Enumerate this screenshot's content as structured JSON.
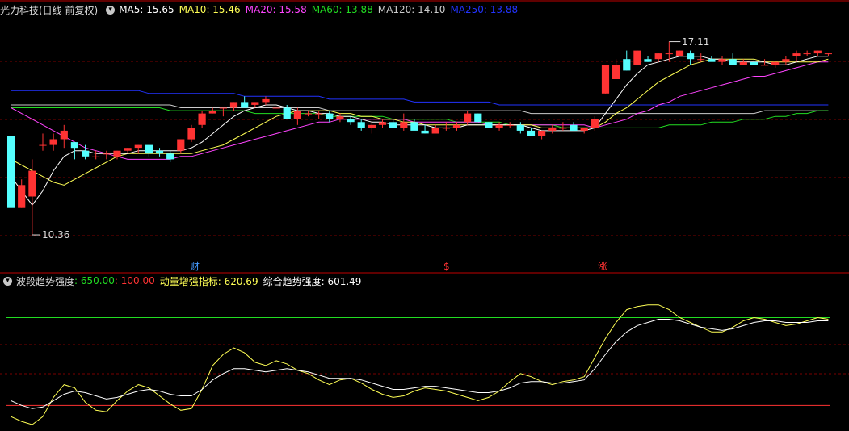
{
  "main_legend": {
    "title": "光力科技(日线 前复权)",
    "ma": [
      {
        "label": "MA5: 15.65",
        "color": "#ffffff"
      },
      {
        "label": "MA10: 15.46",
        "color": "#ffff55"
      },
      {
        "label": "MA20: 15.58",
        "color": "#ff44ff"
      },
      {
        "label": "MA60: 13.88",
        "color": "#22dd22"
      },
      {
        "label": "MA120: 14.10",
        "color": "#cccccc"
      },
      {
        "label": "MA250: 13.88",
        "color": "#2233ff"
      }
    ]
  },
  "sub_legend": {
    "name": "波段趋势强度",
    "val1": ": 650.00",
    "val2": ": 100.00",
    "ind2": "动量增强指标: 620.69",
    "ind3": "综合趋势强度: 601.49"
  },
  "markers": {
    "high": "17.11",
    "low": "10.36",
    "m1": "财",
    "m2": "$",
    "m3": "涨"
  },
  "colors": {
    "up": "#ff3333",
    "down": "#55ffff",
    "grid": "#7a0000",
    "sep": "#c00000"
  },
  "chart_data": [
    {
      "type": "candlestick",
      "title": "光力科技(日线 前复权)",
      "ylim": [
        9.6,
        18.0
      ],
      "ohlc": [
        [
          13.8,
          13.8,
          11.3,
          11.3
        ],
        [
          11.3,
          12.3,
          11.3,
          12.1
        ],
        [
          11.7,
          13.0,
          10.36,
          12.6
        ],
        [
          13.5,
          13.9,
          13.3,
          13.5
        ],
        [
          13.5,
          13.9,
          13.3,
          13.7
        ],
        [
          13.7,
          14.2,
          13.4,
          14.0
        ],
        [
          13.6,
          13.6,
          13.0,
          13.4
        ],
        [
          13.3,
          13.5,
          13.0,
          13.1
        ],
        [
          13.1,
          13.3,
          13.0,
          13.1
        ],
        [
          13.2,
          13.3,
          13.0,
          13.2
        ],
        [
          13.1,
          13.3,
          13.0,
          13.3
        ],
        [
          13.3,
          13.4,
          13.2,
          13.4
        ],
        [
          13.4,
          13.5,
          13.2,
          13.5
        ],
        [
          13.5,
          13.5,
          13.1,
          13.2
        ],
        [
          13.3,
          13.4,
          13.1,
          13.2
        ],
        [
          13.2,
          13.3,
          12.9,
          13.0
        ],
        [
          13.3,
          13.7,
          13.2,
          13.7
        ],
        [
          13.7,
          14.2,
          13.6,
          14.1
        ],
        [
          14.2,
          14.7,
          14.1,
          14.6
        ],
        [
          14.6,
          14.8,
          14.6,
          14.7
        ],
        [
          14.8,
          14.8,
          14.5,
          14.8
        ],
        [
          14.8,
          15.0,
          14.7,
          15.0
        ],
        [
          15.0,
          15.2,
          14.8,
          14.8
        ],
        [
          14.9,
          15.0,
          14.8,
          15.0
        ],
        [
          15.0,
          15.2,
          14.9,
          15.1
        ],
        [
          14.8,
          14.8,
          14.8,
          14.8
        ],
        [
          14.8,
          14.9,
          14.4,
          14.4
        ],
        [
          14.4,
          14.8,
          14.2,
          14.7
        ],
        [
          14.6,
          14.7,
          14.5,
          14.6
        ],
        [
          14.6,
          14.7,
          14.4,
          14.6
        ],
        [
          14.6,
          14.7,
          14.3,
          14.4
        ],
        [
          14.4,
          14.6,
          14.3,
          14.5
        ],
        [
          14.4,
          14.5,
          14.2,
          14.3
        ],
        [
          14.3,
          14.4,
          14.0,
          14.1
        ],
        [
          14.1,
          14.3,
          13.9,
          14.2
        ],
        [
          14.2,
          14.4,
          14.1,
          14.3
        ],
        [
          14.3,
          14.4,
          14.1,
          14.1
        ],
        [
          14.1,
          14.6,
          14.0,
          14.3
        ],
        [
          14.3,
          14.4,
          14.1,
          14.0
        ],
        [
          14.0,
          14.2,
          13.9,
          13.9
        ],
        [
          13.9,
          14.2,
          13.9,
          14.1
        ],
        [
          14.1,
          14.3,
          14.0,
          14.1
        ],
        [
          14.1,
          14.3,
          14.0,
          14.2
        ],
        [
          14.3,
          14.7,
          14.2,
          14.6
        ],
        [
          14.6,
          14.6,
          14.3,
          14.3
        ],
        [
          14.3,
          14.3,
          14.1,
          14.1
        ],
        [
          14.1,
          14.3,
          14.0,
          14.2
        ],
        [
          14.2,
          14.3,
          14.1,
          14.2
        ],
        [
          14.2,
          14.3,
          13.9,
          14.0
        ],
        [
          14.0,
          14.1,
          13.8,
          13.8
        ],
        [
          13.8,
          14.0,
          13.7,
          14.0
        ],
        [
          14.0,
          14.2,
          13.9,
          14.1
        ],
        [
          14.1,
          14.3,
          14.0,
          14.1
        ],
        [
          14.2,
          14.3,
          14.0,
          14.0
        ],
        [
          14.0,
          14.1,
          13.9,
          14.1
        ],
        [
          14.1,
          14.5,
          14.0,
          14.4
        ],
        [
          15.3,
          16.2,
          15.3,
          16.3
        ],
        [
          15.8,
          16.5,
          15.8,
          16.3
        ],
        [
          16.5,
          16.8,
          16.1,
          16.1
        ],
        [
          16.3,
          16.8,
          16.3,
          16.8
        ],
        [
          16.5,
          16.6,
          16.4,
          16.4
        ],
        [
          16.5,
          16.7,
          16.4,
          16.7
        ],
        [
          16.7,
          17.11,
          16.4,
          16.7
        ],
        [
          16.6,
          16.8,
          16.6,
          16.8
        ],
        [
          16.7,
          16.8,
          16.3,
          16.5
        ],
        [
          16.5,
          16.7,
          16.4,
          16.5
        ],
        [
          16.5,
          16.6,
          16.5,
          16.4
        ],
        [
          16.4,
          16.6,
          16.3,
          16.5
        ],
        [
          16.5,
          16.7,
          16.4,
          16.3
        ],
        [
          16.3,
          16.5,
          16.3,
          16.4
        ],
        [
          16.4,
          16.5,
          16.3,
          16.3
        ],
        [
          16.3,
          16.5,
          16.3,
          16.3
        ],
        [
          16.3,
          16.4,
          16.2,
          16.4
        ],
        [
          16.4,
          16.6,
          16.3,
          16.5
        ],
        [
          16.6,
          16.8,
          16.4,
          16.7
        ],
        [
          16.7,
          16.8,
          16.6,
          16.7
        ],
        [
          16.7,
          16.8,
          16.6,
          16.8
        ],
        [
          16.7,
          16.7,
          16.6,
          16.7
        ]
      ],
      "ma5": [
        12.4,
        11.9,
        11.4,
        11.9,
        12.6,
        13.1,
        13.3,
        13.3,
        13.2,
        13.2,
        13.2,
        13.2,
        13.3,
        13.3,
        13.3,
        13.3,
        13.3,
        13.4,
        13.6,
        13.9,
        14.2,
        14.5,
        14.7,
        14.8,
        14.9,
        14.9,
        14.8,
        14.7,
        14.7,
        14.6,
        14.6,
        14.5,
        14.5,
        14.4,
        14.3,
        14.3,
        14.2,
        14.2,
        14.2,
        14.2,
        14.1,
        14.1,
        14.1,
        14.2,
        14.2,
        14.2,
        14.2,
        14.2,
        14.2,
        14.1,
        14.0,
        14.0,
        14.0,
        14.0,
        14.0,
        14.1,
        14.6,
        15.1,
        15.6,
        16.0,
        16.3,
        16.4,
        16.5,
        16.6,
        16.6,
        16.6,
        16.5,
        16.5,
        16.4,
        16.4,
        16.4,
        16.4,
        16.3,
        16.3,
        16.4,
        16.5,
        16.6,
        16.6
      ],
      "ma10": [
        13.0,
        12.8,
        12.6,
        12.4,
        12.2,
        12.1,
        12.3,
        12.5,
        12.7,
        12.9,
        13.1,
        13.2,
        13.2,
        13.2,
        13.2,
        13.2,
        13.2,
        13.2,
        13.3,
        13.4,
        13.5,
        13.7,
        13.9,
        14.1,
        14.3,
        14.5,
        14.6,
        14.7,
        14.7,
        14.7,
        14.7,
        14.6,
        14.6,
        14.5,
        14.5,
        14.4,
        14.4,
        14.3,
        14.3,
        14.2,
        14.2,
        14.2,
        14.2,
        14.2,
        14.2,
        14.2,
        14.2,
        14.2,
        14.2,
        14.2,
        14.1,
        14.1,
        14.1,
        14.1,
        14.1,
        14.1,
        14.3,
        14.6,
        14.8,
        15.1,
        15.4,
        15.7,
        15.9,
        16.1,
        16.3,
        16.4,
        16.5,
        16.5,
        16.5,
        16.5,
        16.5,
        16.4,
        16.4,
        16.4,
        16.4,
        16.4,
        16.4,
        16.5
      ],
      "ma20": [
        14.8,
        14.6,
        14.4,
        14.2,
        14.0,
        13.8,
        13.6,
        13.4,
        13.3,
        13.2,
        13.1,
        13.0,
        13.0,
        13.0,
        13.0,
        13.0,
        13.1,
        13.1,
        13.2,
        13.3,
        13.4,
        13.5,
        13.6,
        13.7,
        13.8,
        13.9,
        14.0,
        14.1,
        14.2,
        14.3,
        14.3,
        14.4,
        14.4,
        14.4,
        14.4,
        14.4,
        14.4,
        14.4,
        14.3,
        14.3,
        14.3,
        14.3,
        14.3,
        14.3,
        14.3,
        14.2,
        14.2,
        14.2,
        14.2,
        14.2,
        14.2,
        14.2,
        14.2,
        14.2,
        14.2,
        14.1,
        14.2,
        14.3,
        14.4,
        14.6,
        14.7,
        14.9,
        15.0,
        15.2,
        15.3,
        15.4,
        15.5,
        15.6,
        15.7,
        15.8,
        15.9,
        15.9,
        16.0,
        16.1,
        16.2,
        16.3,
        16.4,
        16.4
      ],
      "ma60": [
        14.8,
        14.8,
        14.8,
        14.8,
        14.8,
        14.8,
        14.8,
        14.8,
        14.8,
        14.8,
        14.8,
        14.8,
        14.8,
        14.8,
        14.8,
        14.7,
        14.7,
        14.7,
        14.7,
        14.7,
        14.7,
        14.7,
        14.7,
        14.6,
        14.6,
        14.6,
        14.6,
        14.6,
        14.6,
        14.6,
        14.5,
        14.5,
        14.5,
        14.5,
        14.5,
        14.5,
        14.4,
        14.4,
        14.4,
        14.4,
        14.4,
        14.4,
        14.3,
        14.3,
        14.3,
        14.3,
        14.3,
        14.2,
        14.2,
        14.2,
        14.2,
        14.2,
        14.1,
        14.1,
        14.1,
        14.1,
        14.1,
        14.1,
        14.1,
        14.1,
        14.1,
        14.1,
        14.2,
        14.2,
        14.2,
        14.2,
        14.3,
        14.3,
        14.3,
        14.4,
        14.4,
        14.4,
        14.5,
        14.5,
        14.6,
        14.6,
        14.7,
        14.7
      ],
      "ma120": [
        14.9,
        14.9,
        14.9,
        14.9,
        14.9,
        14.9,
        14.9,
        14.9,
        14.9,
        14.9,
        14.9,
        14.9,
        14.9,
        14.9,
        14.9,
        14.9,
        14.8,
        14.8,
        14.8,
        14.8,
        14.8,
        14.8,
        14.8,
        14.8,
        14.8,
        14.8,
        14.8,
        14.8,
        14.8,
        14.8,
        14.7,
        14.7,
        14.7,
        14.7,
        14.7,
        14.7,
        14.7,
        14.7,
        14.7,
        14.7,
        14.7,
        14.7,
        14.7,
        14.7,
        14.7,
        14.7,
        14.7,
        14.7,
        14.7,
        14.6,
        14.6,
        14.6,
        14.6,
        14.6,
        14.6,
        14.6,
        14.6,
        14.6,
        14.6,
        14.6,
        14.6,
        14.6,
        14.6,
        14.6,
        14.6,
        14.6,
        14.6,
        14.6,
        14.6,
        14.6,
        14.6,
        14.7,
        14.7,
        14.7,
        14.7,
        14.7,
        14.7,
        14.7
      ],
      "ma250": [
        15.4,
        15.4,
        15.4,
        15.4,
        15.4,
        15.4,
        15.4,
        15.4,
        15.4,
        15.4,
        15.4,
        15.4,
        15.4,
        15.3,
        15.3,
        15.3,
        15.3,
        15.3,
        15.3,
        15.3,
        15.3,
        15.3,
        15.2,
        15.2,
        15.2,
        15.2,
        15.2,
        15.2,
        15.2,
        15.2,
        15.1,
        15.1,
        15.1,
        15.1,
        15.1,
        15.1,
        15.1,
        15.1,
        15.0,
        15.0,
        15.0,
        15.0,
        15.0,
        15.0,
        15.0,
        15.0,
        14.9,
        14.9,
        14.9,
        14.9,
        14.9,
        14.9,
        14.9,
        14.9,
        14.9,
        14.9,
        14.9,
        14.9,
        14.9,
        14.9,
        14.9,
        14.9,
        14.9,
        14.9,
        14.9,
        14.9,
        14.9,
        14.9,
        14.9,
        14.9,
        14.9,
        14.9,
        14.9,
        14.9,
        14.9,
        14.9,
        14.9,
        14.9
      ]
    },
    {
      "type": "line",
      "title": "波段趋势强度",
      "ylim": [
        -50,
        860
      ],
      "hlines": [
        {
          "value": 650,
          "color": "#22dd22"
        },
        {
          "value": 100,
          "color": "#ff3333"
        }
      ],
      "series": [
        {
          "name": "动量增强指标",
          "color": "#ffff55",
          "values": [
            30,
            0,
            -20,
            30,
            150,
            230,
            210,
            120,
            70,
            60,
            130,
            190,
            230,
            210,
            160,
            110,
            70,
            80,
            200,
            350,
            420,
            460,
            430,
            370,
            350,
            380,
            360,
            320,
            300,
            260,
            230,
            260,
            270,
            240,
            200,
            170,
            150,
            160,
            190,
            210,
            200,
            190,
            170,
            150,
            130,
            150,
            190,
            250,
            300,
            280,
            250,
            230,
            250,
            260,
            280,
            400,
            520,
            620,
            700,
            720,
            730,
            730,
            700,
            650,
            620,
            590,
            560,
            560,
            590,
            630,
            650,
            640,
            620,
            600,
            610,
            630,
            650,
            640
          ]
        },
        {
          "name": "综合趋势强度",
          "color": "#ffffff",
          "values": [
            130,
            100,
            80,
            90,
            130,
            170,
            190,
            180,
            160,
            140,
            150,
            170,
            190,
            200,
            190,
            170,
            160,
            160,
            200,
            260,
            300,
            330,
            330,
            320,
            310,
            320,
            330,
            320,
            310,
            290,
            270,
            270,
            270,
            260,
            240,
            220,
            200,
            200,
            210,
            220,
            220,
            210,
            200,
            190,
            180,
            180,
            190,
            210,
            240,
            250,
            250,
            240,
            240,
            250,
            260,
            330,
            420,
            500,
            560,
            600,
            620,
            640,
            640,
            630,
            610,
            590,
            580,
            570,
            580,
            600,
            620,
            630,
            630,
            620,
            620,
            620,
            630,
            630
          ]
        }
      ]
    }
  ]
}
